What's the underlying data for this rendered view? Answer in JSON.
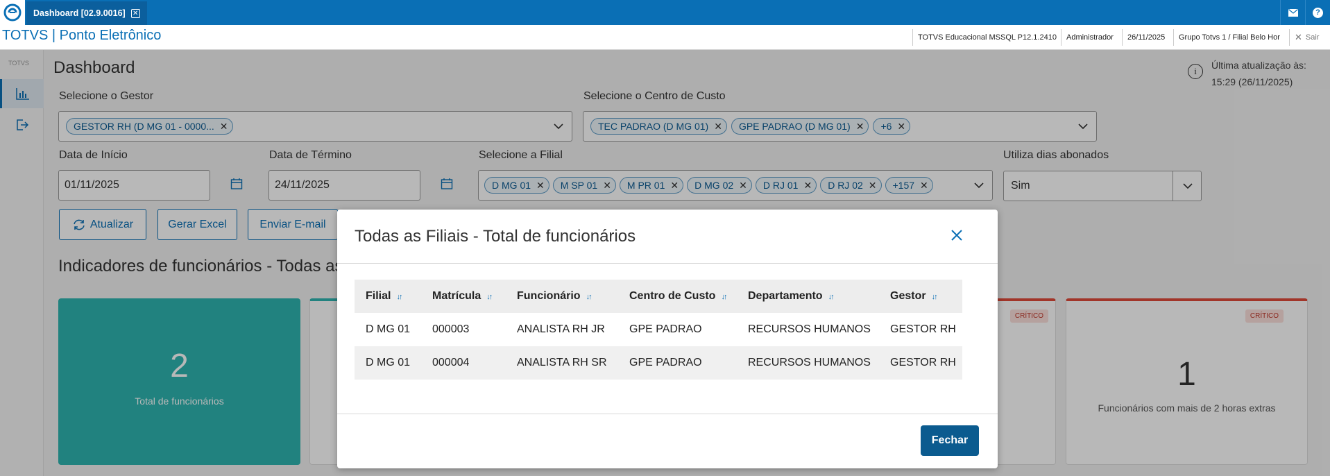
{
  "window": {
    "tab_label": "Dashboard [02.9.0016]",
    "tab_close": "✕"
  },
  "header": {
    "app_title": "TOTVS | Ponto Eletrônico",
    "environment": "TOTVS Educacional MSSQL P12.1.2410",
    "user": "Administrador",
    "date": "26/11/2025",
    "branch": "Grupo Totvs 1 / Filial Belo Hor",
    "logout": "Sair"
  },
  "sidebar": {
    "logo_text": "TOTVS"
  },
  "dashboard": {
    "title": "Dashboard",
    "last_update_label": "Última atualização às:",
    "last_update_value": "15:29 (26/11/2025)",
    "gestor_label": "Selecione o Gestor",
    "gestor_chips": [
      "GESTOR RH (D MG 01 - 0000..."
    ],
    "centro_label": "Selecione o Centro de Custo",
    "centro_chips": [
      "TEC PADRAO (D MG 01)",
      "GPE PADRAO (D MG 01)",
      "+6"
    ],
    "data_inicio_label": "Data de Início",
    "data_inicio_value": "01/11/2025",
    "data_termino_label": "Data de Término",
    "data_termino_value": "24/11/2025",
    "filial_label": "Selecione a Filial",
    "filial_chips": [
      "D MG 01",
      "M SP 01",
      "M PR 01",
      "D MG 02",
      "D RJ 01",
      "D RJ 02",
      "+157"
    ],
    "abonados_label": "Utiliza dias abonados",
    "abonados_value": "Sim",
    "btn_atualizar": "Atualizar",
    "btn_excel": "Gerar Excel",
    "btn_email": "Enviar E-mail",
    "section_title": "Indicadores de funcionários - Todas as",
    "card_total_value": "2",
    "card_total_label": "Total de funcionários",
    "badge_critico_1": "CRÍTICO",
    "badge_critico_2": "CRÍTICO",
    "card_extras_value": "1",
    "card_extras_label": "Funcionários com mais de 2 horas extras"
  },
  "modal": {
    "title": "Todas as Filiais - Total de funcionários",
    "columns": [
      "Filial",
      "Matrícula",
      "Funcionário",
      "Centro de Custo",
      "Departamento",
      "Gestor"
    ],
    "rows": [
      [
        "D MG 01",
        "000003",
        "ANALISTA RH JR",
        "GPE PADRAO",
        "RECURSOS HUMANOS",
        "GESTOR RH"
      ],
      [
        "D MG 01",
        "000004",
        "ANALISTA RH SR",
        "GPE PADRAO",
        "RECURSOS HUMANOS",
        "GESTOR RH"
      ]
    ],
    "close_button": "Fechar"
  },
  "colors": {
    "brand_blue": "#0a6fb5",
    "teal_card": "#2fb5b0",
    "critical_red": "#e04a3a",
    "primary_button": "#0b5b8f"
  }
}
